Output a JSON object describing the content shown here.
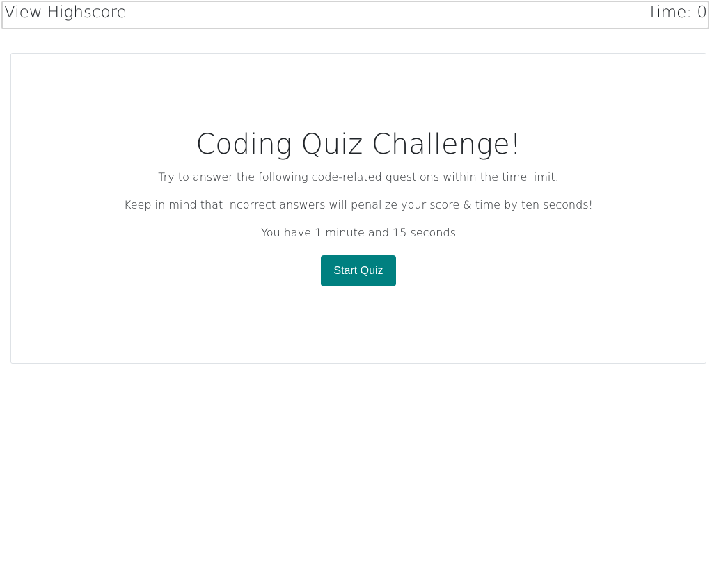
{
  "header": {
    "highscore_link": "View Highscore",
    "timer_label": "Time:",
    "timer_value": "0"
  },
  "intro": {
    "title": "Coding Quiz Challenge!",
    "line1": "Try to answer the following code-related questions within the time limit.",
    "line2": "Keep in mind that incorrect answers will penalize your score & time by ten seconds!",
    "line3": "You have 1 minute and 15 seconds",
    "start_button": "Start Quiz"
  },
  "colors": {
    "accent": "#008080",
    "header_border": "#d3d3d3",
    "card_border": "#dee2e6",
    "text": "#212529"
  }
}
